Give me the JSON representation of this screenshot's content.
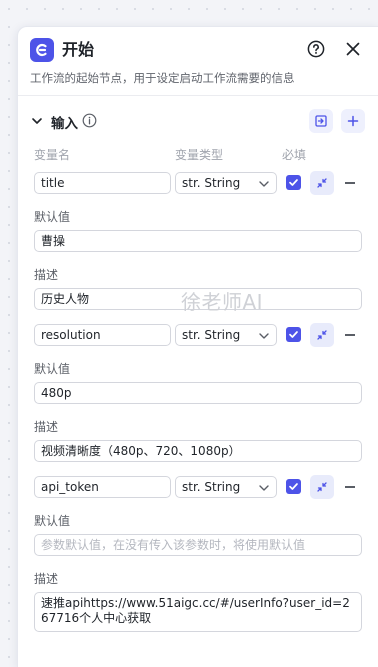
{
  "header": {
    "title": "开始",
    "description": "工作流的起始节点，用于设定启动工作流需要的信息"
  },
  "section": {
    "title": "输入",
    "columns": {
      "name": "变量名",
      "type": "变量类型",
      "required": "必填"
    }
  },
  "fields": [
    {
      "name": "title",
      "type": "str. String",
      "required": true,
      "default_label": "默认值",
      "default_value": "曹操",
      "default_placeholder": "",
      "desc_label": "描述",
      "desc_value": "历史人物"
    },
    {
      "name": "resolution",
      "type": "str. String",
      "required": true,
      "default_label": "默认值",
      "default_value": "480p",
      "default_placeholder": "",
      "desc_label": "描述",
      "desc_value": "视频清晰度（480p、720、1080p）"
    },
    {
      "name": "api_token",
      "type": "str. String",
      "required": true,
      "default_label": "默认值",
      "default_value": "",
      "default_placeholder": "参数默认值，在没有传入该参数时，将使用默认值",
      "desc_label": "描述",
      "desc_value": "速推apihttps://www.51aigc.cc/#/userInfo?user_id=267716个人中心获取"
    }
  ],
  "watermark": "徐老师AI",
  "colors": {
    "accent": "#4d53e8",
    "accent_light": "#e8ebfb"
  },
  "icons": {
    "app": "start-node-icon",
    "help": "question-circle-icon",
    "close": "close-icon",
    "chevron": "chevron-down-icon",
    "info": "info-circle-icon",
    "import": "import-icon",
    "add": "plus-icon",
    "collapse": "collapse-arrows-icon",
    "remove": "minus-icon"
  }
}
